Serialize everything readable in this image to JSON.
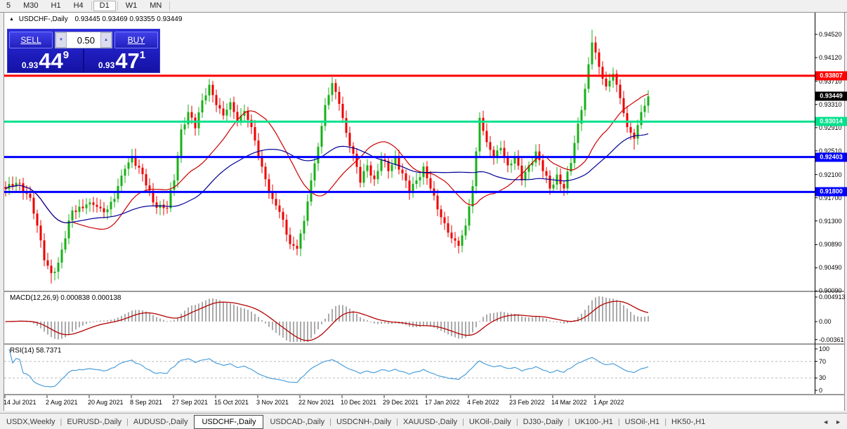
{
  "toolbar": {
    "timeframes": [
      "5",
      "M30",
      "H1",
      "H4",
      "D1",
      "W1",
      "MN"
    ],
    "active": "D1"
  },
  "title": {
    "arrow": "▲",
    "symbol": "USDCHF-,Daily",
    "ohlc": "0.93445 0.93469 0.93355 0.93449"
  },
  "trade_panel": {
    "sell_label": "SELL",
    "buy_label": "BUY",
    "volume": "0.50",
    "down_arrow": "▼",
    "up_arrow": "▲",
    "sell_price": {
      "small": "0.93",
      "big": "44",
      "sup": "9"
    },
    "buy_price": {
      "small": "0.93",
      "big": "47",
      "sup": "1"
    }
  },
  "price_axis": {
    "labels": [
      "0.94520",
      "0.94120",
      "0.93710",
      "0.93310",
      "0.92910",
      "0.92510",
      "0.92100",
      "0.91700",
      "0.91300",
      "0.90890",
      "0.90490",
      "0.90090"
    ]
  },
  "badges": [
    {
      "label": "0.93807",
      "color": "#ff0000"
    },
    {
      "label": "0.93449",
      "color": "#000000"
    },
    {
      "label": "0.93014",
      "color": "#00e18c"
    },
    {
      "label": "0.92403",
      "color": "#0000ff"
    },
    {
      "label": "0.91800",
      "color": "#0000ff"
    }
  ],
  "hlines": [
    {
      "price": 0.93807,
      "color": "#ff0000"
    },
    {
      "price": 0.93014,
      "color": "#00e18c"
    },
    {
      "price": 0.92403,
      "color": "#0000ff"
    },
    {
      "price": 0.918,
      "color": "#0000ff"
    }
  ],
  "macd": {
    "label": "MACD(12,26,9) 0.000838 0.000138",
    "fast": 12,
    "slow": 26,
    "signal": 9,
    "axis_labels": [
      {
        "text": "0.004913",
        "value": 0.004913
      },
      {
        "text": "0.00",
        "value": 0
      },
      {
        "text": "-0.00361",
        "value": -0.00361
      }
    ]
  },
  "rsi": {
    "label": "RSI(14) 58.7371",
    "period": 14,
    "levels": [
      {
        "text": "100",
        "value": 100,
        "dashed": false
      },
      {
        "text": "70",
        "value": 70,
        "dashed": true
      },
      {
        "text": "30",
        "value": 30,
        "dashed": true
      },
      {
        "text": "0",
        "value": 0,
        "dashed": false
      }
    ]
  },
  "date_axis": [
    "14 Jul 2021",
    "2 Aug 2021",
    "20 Aug 2021",
    "8 Sep 2021",
    "27 Sep 2021",
    "15 Oct 2021",
    "3 Nov 2021",
    "22 Nov 2021",
    "10 Dec 2021",
    "29 Dec 2021",
    "17 Jan 2022",
    "4 Feb 2022",
    "23 Feb 2022",
    "14 Mar 2022",
    "1 Apr 2022"
  ],
  "tabs": {
    "items": [
      "USDX,Weekly",
      "EURUSD-,Daily",
      "AUDUSD-,Daily",
      "USDCHF-,Daily",
      "USDCAD-,Daily",
      "USDCNH-,Daily",
      "XAUUSD-,Daily",
      "UKOil-,Daily",
      "DJ30-,Daily",
      "UK100-,H1",
      "USOil-,H1",
      "HK50-,H1"
    ],
    "active": "USDCHF-,Daily",
    "left_arrow": "◄",
    "right_arrow": "►"
  },
  "colors": {
    "bull": "#18b018",
    "bear": "#ee0000",
    "ma_fast": "#cc0000",
    "ma_slow": "#000099",
    "macd_hist": "#ababab",
    "macd_signal": "#b40000",
    "rsi_line": "#4c9fdc",
    "level_dash": "#bbbbbb",
    "hline_red": "#ff0000",
    "hline_green": "#00e18c",
    "hline_blue": "#0000ff"
  },
  "chart_data": {
    "type": "candlestick",
    "symbol": "USDCHF",
    "timeframe": "Daily",
    "visible_high": 0.946,
    "visible_low": 0.902,
    "candle_count": 184,
    "close_anchors": [
      [
        0,
        0.9185
      ],
      [
        4,
        0.9195
      ],
      [
        7,
        0.917
      ],
      [
        9,
        0.9122
      ],
      [
        11,
        0.9062
      ],
      [
        13,
        0.904
      ],
      [
        15,
        0.9058
      ],
      [
        17,
        0.91
      ],
      [
        19,
        0.9148
      ],
      [
        24,
        0.9162
      ],
      [
        28,
        0.9145
      ],
      [
        31,
        0.9168
      ],
      [
        34,
        0.922
      ],
      [
        36,
        0.9242
      ],
      [
        38,
        0.9222
      ],
      [
        42,
        0.9162
      ],
      [
        46,
        0.9152
      ],
      [
        48,
        0.92
      ],
      [
        50,
        0.9288
      ],
      [
        52,
        0.9318
      ],
      [
        54,
        0.929
      ],
      [
        56,
        0.9338
      ],
      [
        58,
        0.9365
      ],
      [
        60,
        0.933
      ],
      [
        62,
        0.9312
      ],
      [
        64,
        0.9335
      ],
      [
        66,
        0.9302
      ],
      [
        68,
        0.932
      ],
      [
        70,
        0.9292
      ],
      [
        72,
        0.9242
      ],
      [
        74,
        0.9202
      ],
      [
        76,
        0.9168
      ],
      [
        79,
        0.9132
      ],
      [
        81,
        0.909
      ],
      [
        83,
        0.9082
      ],
      [
        85,
        0.913
      ],
      [
        87,
        0.92
      ],
      [
        89,
        0.9258
      ],
      [
        91,
        0.933
      ],
      [
        93,
        0.9368
      ],
      [
        95,
        0.9332
      ],
      [
        97,
        0.9282
      ],
      [
        99,
        0.9246
      ],
      [
        101,
        0.9196
      ],
      [
        103,
        0.9226
      ],
      [
        105,
        0.9202
      ],
      [
        107,
        0.9236
      ],
      [
        109,
        0.9216
      ],
      [
        111,
        0.924
      ],
      [
        113,
        0.9212
      ],
      [
        115,
        0.9178
      ],
      [
        117,
        0.92
      ],
      [
        119,
        0.9224
      ],
      [
        121,
        0.9186
      ],
      [
        123,
        0.915
      ],
      [
        125,
        0.9126
      ],
      [
        127,
        0.91
      ],
      [
        129,
        0.9087
      ],
      [
        131,
        0.9122
      ],
      [
        133,
        0.919
      ],
      [
        135,
        0.9308
      ],
      [
        137,
        0.9266
      ],
      [
        139,
        0.924
      ],
      [
        141,
        0.9256
      ],
      [
        143,
        0.9226
      ],
      [
        145,
        0.924
      ],
      [
        147,
        0.92
      ],
      [
        149,
        0.9226
      ],
      [
        151,
        0.925
      ],
      [
        153,
        0.9216
      ],
      [
        155,
        0.9186
      ],
      [
        157,
        0.921
      ],
      [
        159,
        0.9186
      ],
      [
        161,
        0.923
      ],
      [
        163,
        0.9298
      ],
      [
        165,
        0.9358
      ],
      [
        167,
        0.9438
      ],
      [
        169,
        0.9396
      ],
      [
        171,
        0.9362
      ],
      [
        173,
        0.9384
      ],
      [
        175,
        0.9342
      ],
      [
        177,
        0.9292
      ],
      [
        179,
        0.9272
      ],
      [
        181,
        0.9318
      ],
      [
        183,
        0.9345
      ]
    ],
    "wick_overrides": {
      "13": {
        "low": 0.9022
      },
      "58": {
        "high": 0.9375
      },
      "93": {
        "high": 0.9378
      },
      "167": {
        "high": 0.946
      },
      "179": {
        "low": 0.9253
      }
    },
    "ma_fast_period": 20,
    "ma_slow_period": 46
  }
}
